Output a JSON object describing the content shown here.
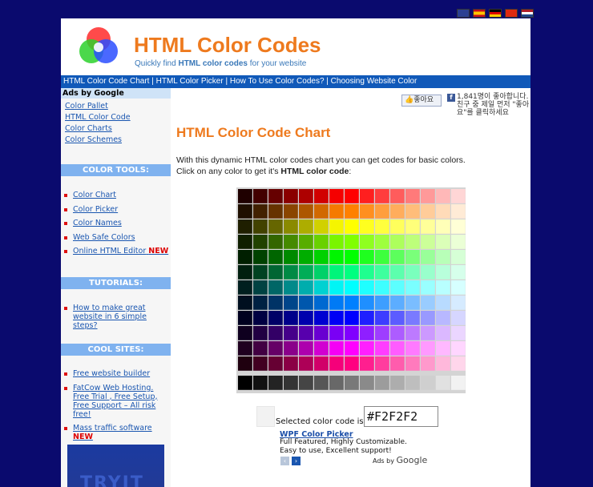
{
  "flags": [
    {
      "name": "uk-flag",
      "color": "#2b3f93"
    },
    {
      "name": "spain-flag",
      "color": "#e0b000"
    },
    {
      "name": "germany-flag",
      "color": "#c00000"
    },
    {
      "name": "china-flag",
      "color": "#de2910"
    },
    {
      "name": "netherlands-flag",
      "color": "#21468b"
    }
  ],
  "header": {
    "title": "HTML Color Codes",
    "tagline_prefix": "Quickly find ",
    "tagline_bold": "HTML color codes",
    "tagline_suffix": " for your website"
  },
  "topnav": [
    "HTML Color Code Chart",
    "HTML Color Picker",
    "How To Use Color Codes?",
    "Choosing Website Color"
  ],
  "sidebar": {
    "ads_title": "Ads by Google",
    "ads_links": [
      "Color Pallet",
      "HTML Color Code",
      "Color Charts",
      "Color Schemes"
    ],
    "color_tools_title": "COLOR TOOLS:",
    "color_tools": [
      "Color Chart",
      "Color Picker",
      "Color Names",
      "Web Safe Colors",
      "Online HTML Editor"
    ],
    "new_badge": "NEW",
    "tutorials_title": "TUTORIALS:",
    "tutorials": [
      "How to make great website in 6 simple steps?"
    ],
    "cool_sites_title": "COOL SITES:",
    "cool_sites": [
      "Free website builder",
      "FatCow Web Hosting. Free Trial , Free Setup, Free Support – All risk free!",
      "Mass traffic software"
    ],
    "banner_text": "TRYIT"
  },
  "social": {
    "like_label": "좋아요",
    "like_text": "1,841명이 좋아합니다. 친구 중 제일 먼저 \"좋아요\"를 클릭하세요"
  },
  "main": {
    "title": "HTML Color Code Chart",
    "intro_line1": "With this dynamic HTML color codes chart you can get codes for basic colors.",
    "intro_line2_prefix": "Click on any color to get it's ",
    "intro_line2_bold": "HTML color code",
    "intro_line2_suffix": ":"
  },
  "selection": {
    "label": "Selected color code is:",
    "value": "#F2F2F2",
    "preview_color": "#F2F2F2"
  },
  "ad": {
    "link": "WPF Color Picker",
    "line1": "Full Featured, Highly Customizable.",
    "line2": "Easy to use, Excellent support!",
    "ads_by": "Ads by",
    "google": "Google"
  }
}
